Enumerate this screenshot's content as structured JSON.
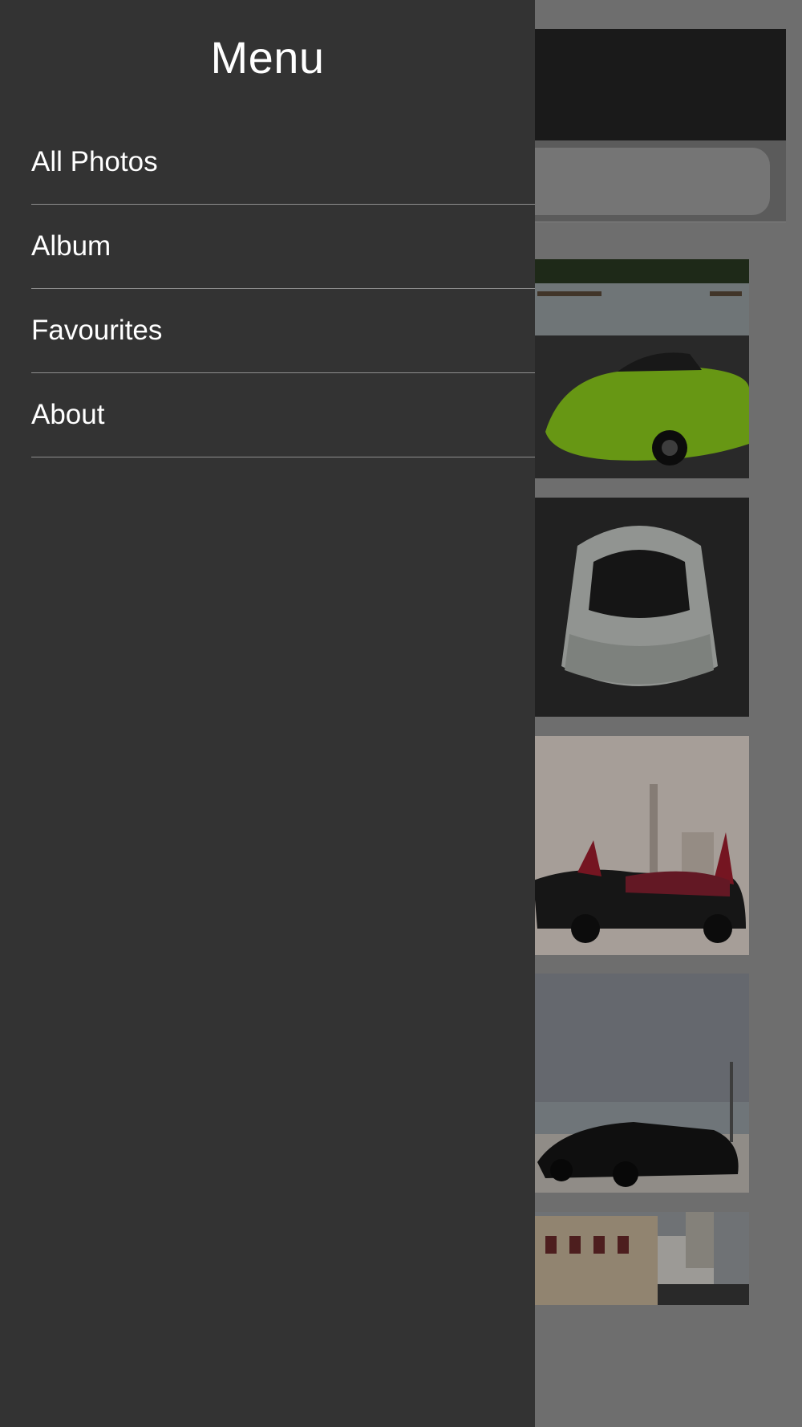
{
  "drawer": {
    "title": "Menu",
    "items": [
      {
        "label": "All Photos"
      },
      {
        "label": "Album"
      },
      {
        "label": "Favourites"
      },
      {
        "label": "About"
      }
    ]
  },
  "background": {
    "photos": [
      {
        "name": "green-lamborghini-roadster"
      },
      {
        "name": "silver-lamborghini-top-view"
      },
      {
        "name": "red-lamborghini-doors-up"
      },
      {
        "name": "black-lamborghini-seaside"
      },
      {
        "name": "street-buildings"
      }
    ]
  }
}
